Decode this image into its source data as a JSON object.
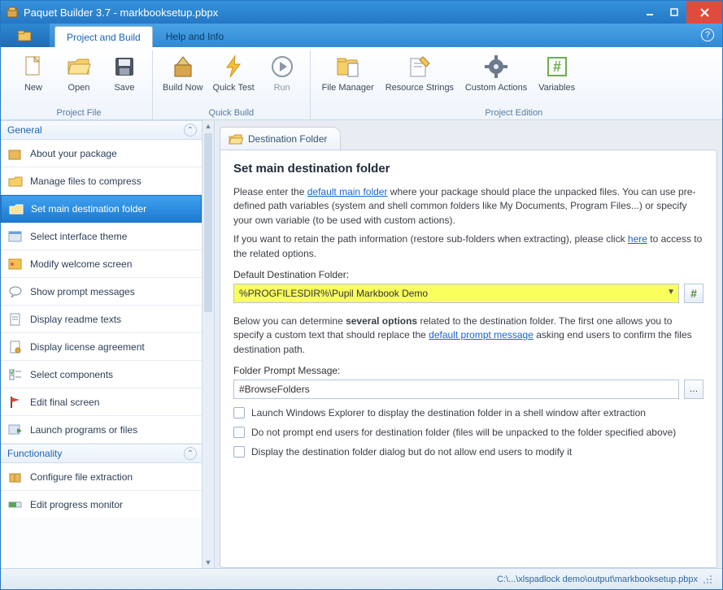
{
  "title": "Paquet Builder 3.7 - markbooksetup.pbpx",
  "tabs": {
    "active": "Project and Build",
    "other": "Help and Info"
  },
  "ribbon": {
    "groups": [
      {
        "label": "Project File",
        "items": [
          "New",
          "Open",
          "Save"
        ]
      },
      {
        "label": "Quick Build",
        "items": [
          "Build Now",
          "Quick Test",
          "Run"
        ]
      },
      {
        "label": "Project Edition",
        "items": [
          "File Manager",
          "Resource Strings",
          "Custom Actions",
          "Variables"
        ]
      }
    ]
  },
  "sidebar": {
    "sections": [
      {
        "title": "General",
        "items": [
          "About your package",
          "Manage files to compress",
          "Set main destination folder",
          "Select interface theme",
          "Modify welcome screen",
          "Show prompt messages",
          "Display readme texts",
          "Display license agreement",
          "Select components",
          "Edit final screen",
          "Launch programs or files"
        ],
        "activeIndex": 2
      },
      {
        "title": "Functionality",
        "items": [
          "Configure file extraction",
          "Edit progress monitor"
        ]
      }
    ]
  },
  "content": {
    "tabLabel": "Destination Folder",
    "heading": "Set main destination folder",
    "intro_pre": "Please enter the ",
    "intro_link1": "default main folder",
    "intro_post1": " where your package should place the unpacked files. You can use pre-defined path variables (system and shell common folders like My Documents, Program Files...) or specify your own variable (to be used with custom actions).",
    "intro_retain_pre": "If you want to retain the path information (restore sub-folders when extracting), please click ",
    "intro_link2": "here",
    "intro_retain_post": " to access to the related options.",
    "destLabel": "Default Destination Folder:",
    "destValue": "%PROGFILESDIR%\\Pupil Markbook Demo",
    "below_pre": "Below you can determine ",
    "below_bold": "several options",
    "below_mid": " related to the destination folder. The first one allows you to specify a custom text that should replace the ",
    "below_link": "default prompt message",
    "below_post": " asking end users to confirm the files destination path.",
    "promptLabel": "Folder Prompt Message:",
    "promptValue": "#BrowseFolders",
    "checks": [
      "Launch Windows Explorer to display the destination folder in a shell window after extraction",
      "Do not prompt end users for destination folder (files will be unpacked to the folder specified above)",
      "Display the destination folder dialog but do not allow end users to modify it"
    ]
  },
  "status": "C:\\...\\xlspadlock demo\\output\\markbooksetup.pbpx"
}
